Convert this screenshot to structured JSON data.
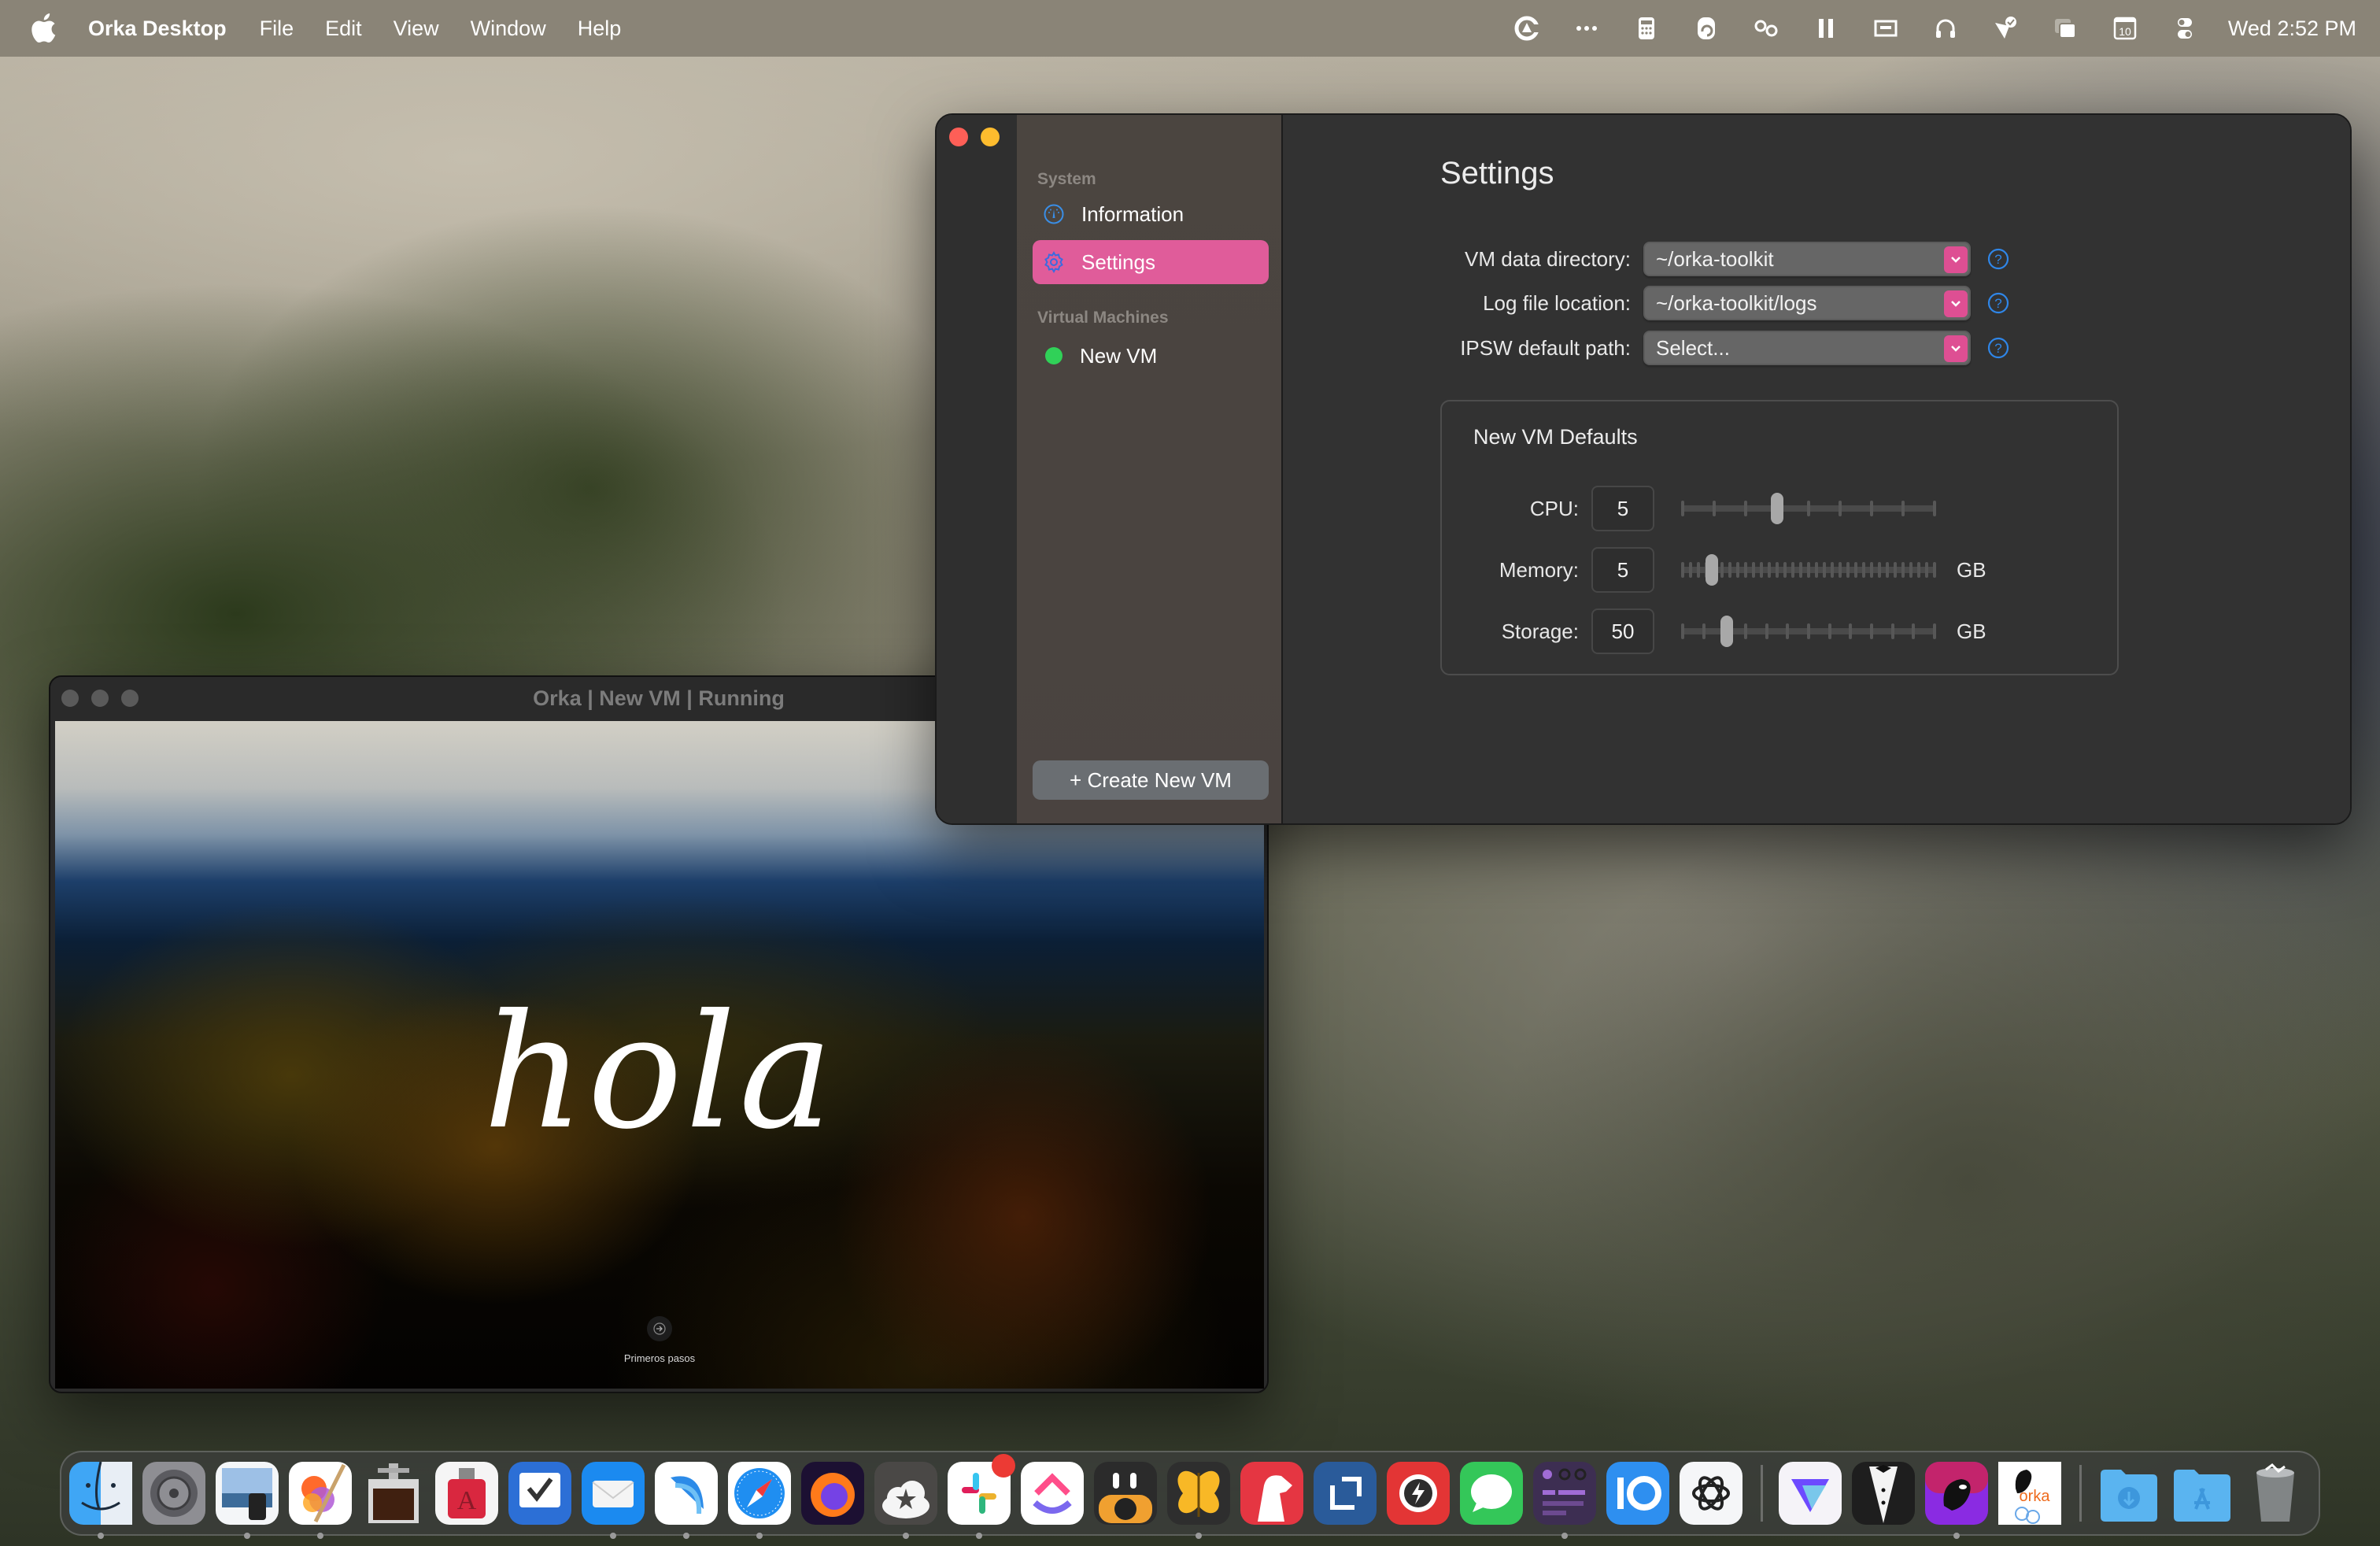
{
  "menubar": {
    "app_name": "Orka Desktop",
    "menus": [
      "File",
      "Edit",
      "View",
      "Window",
      "Help"
    ],
    "tray_icons": [
      "creative-cloud-icon",
      "more-icon",
      "calculator-icon",
      "sync-icon",
      "glasses-icon",
      "pause-icon",
      "display-icon",
      "headphones-icon",
      "checkmark-icon",
      "window-stack-icon",
      "calendar-date-icon",
      "control-center-icon"
    ],
    "calendar_day": "10",
    "clock": "Wed 2:52 PM"
  },
  "settings_window": {
    "sidebar": {
      "system_section": "System",
      "items": [
        {
          "label": "Information",
          "icon": "gauge-icon",
          "active": false
        },
        {
          "label": "Settings",
          "icon": "gear-icon",
          "active": true
        }
      ],
      "vm_section": "Virtual Machines",
      "vms": [
        {
          "label": "New VM",
          "status": "running",
          "status_color": "#30d158"
        }
      ],
      "create_button": "+ Create New VM"
    },
    "main": {
      "title": "Settings",
      "fields": [
        {
          "label": "VM data directory:",
          "value": "~/orka-toolkit"
        },
        {
          "label": "Log file location:",
          "value": "~/orka-toolkit/logs"
        },
        {
          "label": "IPSW default path:",
          "value": "Select..."
        }
      ],
      "defaults": {
        "title": "New VM Defaults",
        "sliders": [
          {
            "label": "CPU:",
            "value": "5",
            "unit": "",
            "fraction": 0.375,
            "ticks": 9
          },
          {
            "label": "Memory:",
            "value": "5",
            "unit": "GB",
            "fraction": 0.12,
            "ticks": 33
          },
          {
            "label": "Storage:",
            "value": "50",
            "unit": "GB",
            "fraction": 0.18,
            "ticks": 13
          }
        ]
      }
    },
    "accent_color": "#e05c9a"
  },
  "vm_window": {
    "title": "Orka | New VM | Running",
    "screen": {
      "greeting": "hola",
      "button_label": "Primeros pasos"
    }
  },
  "dock": {
    "apps": [
      {
        "name": "Finder",
        "running": true
      },
      {
        "name": "System Settings",
        "running": false
      },
      {
        "name": "Preview",
        "running": true
      },
      {
        "name": "Pixelmator Pro",
        "running": true
      },
      {
        "name": "Image Capture",
        "running": false
      },
      {
        "name": "TextSoap",
        "running": false
      },
      {
        "name": "OmniFocus",
        "running": false
      },
      {
        "name": "Mail",
        "running": true
      },
      {
        "name": "Migration App",
        "running": true
      },
      {
        "name": "Safari",
        "running": true
      },
      {
        "name": "Firefox",
        "running": false
      },
      {
        "name": "Reeder",
        "running": true
      },
      {
        "name": "Slack",
        "running": true,
        "badge": true
      },
      {
        "name": "ClickUp",
        "running": false
      },
      {
        "name": "Mimestream",
        "running": false
      },
      {
        "name": "Tes",
        "running": true
      },
      {
        "name": "Bear",
        "running": false
      },
      {
        "name": "Screens",
        "running": false
      },
      {
        "name": "Quick Search",
        "running": false
      },
      {
        "name": "Messages",
        "running": false
      },
      {
        "name": "Notes App",
        "running": true
      },
      {
        "name": "IO",
        "running": false
      },
      {
        "name": "ChatGPT",
        "running": false
      }
    ],
    "apps_secondary": [
      {
        "name": "Proton VPN",
        "running": false
      },
      {
        "name": "Bartender",
        "running": false
      },
      {
        "name": "Orka",
        "running": true
      },
      {
        "name": "Orka Desktop",
        "running": false
      }
    ],
    "folders": [
      {
        "name": "Downloads"
      },
      {
        "name": "Applications"
      },
      {
        "name": "Trash"
      }
    ]
  }
}
